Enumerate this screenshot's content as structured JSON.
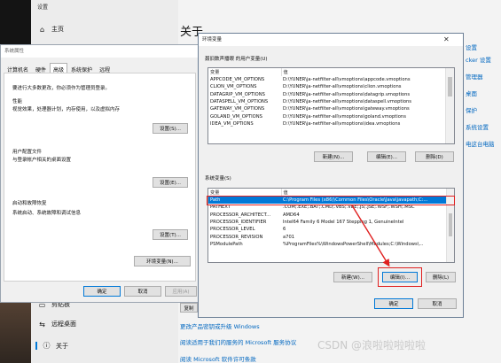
{
  "settings": {
    "window_title": "设置",
    "nav_home": "主页",
    "nav_clipboard": "剪贴板",
    "nav_remote": "远程桌面",
    "nav_about": "关于",
    "page_heading": "关于",
    "right_links": [
      "设置",
      "cker 设置",
      "管理器",
      "桌面",
      "保护",
      "系统设置",
      "电这台电脑"
    ],
    "bottom_links": [
      "更改产品密钥或升级 Windows",
      "阅读适用于我们的服务的 Microsoft 服务协议",
      "阅读 Microsoft 软件许可条款"
    ],
    "copy_button": "复制"
  },
  "sysprop": {
    "title": "系统属性",
    "tabs": [
      "计算机名",
      "硬件",
      "高级",
      "系统保护",
      "远程"
    ],
    "active_tab": "高级",
    "admin_note": "要进行大多数更改，你必须作为管理员登录。",
    "performance": {
      "heading": "性能",
      "desc": "视觉效果，处理器计划，内存使用，以及虚拟内存",
      "button": "设置(S)..."
    },
    "profiles": {
      "heading": "用户配置文件",
      "desc": "与登录帐户相关的桌面设置",
      "button": "设置(E)..."
    },
    "startup": {
      "heading": "启动和故障恢复",
      "desc": "系统启动、系统故障和调试信息",
      "button": "设置(T)..."
    },
    "env_button": "环境变量(N)...",
    "ok": "确定",
    "cancel": "取消",
    "apply": "应用(A)"
  },
  "env": {
    "title": "环境变量",
    "user_section": "聂旧数声播眼 的用户变量(U)",
    "col_var": "变量",
    "col_val": "值",
    "user_vars": [
      {
        "name": "APPCODE_VM_OPTIONS",
        "value": "D:\\YUNER\\ja-netfilter-all\\vmoptions\\appcode.vmoptions"
      },
      {
        "name": "CLION_VM_OPTIONS",
        "value": "D:\\YUNER\\ja-netfilter-all\\vmoptions\\clion.vmoptions"
      },
      {
        "name": "DATAGRIP_VM_OPTIONS",
        "value": "D:\\YUNER\\ja-netfilter-all\\vmoptions\\datagrip.vmoptions"
      },
      {
        "name": "DATASPELL_VM_OPTIONS",
        "value": "D:\\YUNER\\ja-netfilter-all\\vmoptions\\dataspell.vmoptions"
      },
      {
        "name": "GATEWAY_VM_OPTIONS",
        "value": "D:\\YUNER\\ja-netfilter-all\\vmoptions\\gateway.vmoptions"
      },
      {
        "name": "GOLAND_VM_OPTIONS",
        "value": "D:\\YUNER\\ja-netfilter-all\\vmoptions\\goland.vmoptions"
      },
      {
        "name": "IDEA_VM_OPTIONS",
        "value": "D:\\YUNER\\ja-netfilter-all\\vmoptions\\idea.vmoptions"
      }
    ],
    "user_buttons": [
      "新建(N)...",
      "编辑(E)...",
      "删除(D)"
    ],
    "system_section": "系统变量(S)",
    "system_vars": [
      {
        "name": "Path",
        "value": "C:\\Program Files (x86)\\Common Files\\Oracle\\Java\\javapath;C:..."
      },
      {
        "name": "PATHEXT",
        "value": ".COM;.EXE;.BAT;.CMD;.VBS;.VBE;.JS;.JSE;.WSF;.WSH;.MSC"
      },
      {
        "name": "PROCESSOR_ARCHITECT...",
        "value": "AMD64"
      },
      {
        "name": "PROCESSOR_IDENTIFIER",
        "value": "Intel64 Family 6 Model 167 Stepping 1, GenuineIntel"
      },
      {
        "name": "PROCESSOR_LEVEL",
        "value": "6"
      },
      {
        "name": "PROCESSOR_REVISION",
        "value": "a701"
      },
      {
        "name": "PSModulePath",
        "value": "%ProgramFiles%\\WindowsPowerShell\\Modules;C:\\Windows\\..."
      }
    ],
    "system_buttons": [
      "新建(W)...",
      "编辑(I)...",
      "删除(L)"
    ],
    "ok": "确定",
    "cancel": "取消"
  },
  "watermark": "CSDN @浪啦啦啦啦啦",
  "colors": {
    "accent": "#0078d7",
    "highlight": "#e02020",
    "link": "#0067c0"
  }
}
